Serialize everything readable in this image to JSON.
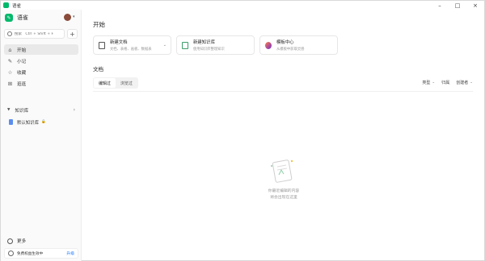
{
  "window": {
    "title": "语雀"
  },
  "sidebar": {
    "brand": "语雀",
    "search_placeholder": "搜索   Ctrl + Shift + F",
    "nav": [
      {
        "label": "开始",
        "icon": "home-icon"
      },
      {
        "label": "小记",
        "icon": "pen-icon"
      },
      {
        "label": "收藏",
        "icon": "star-icon"
      },
      {
        "label": "逛逛",
        "icon": "grid-icon"
      }
    ],
    "knowledge_base": {
      "label": "知识库",
      "items": [
        {
          "label": "默认知识库"
        }
      ]
    },
    "more": "更多",
    "upgrade": {
      "text": "免费权益生效中",
      "link": "升级"
    }
  },
  "main": {
    "heading": "开始",
    "cards": [
      {
        "title": "新建文档",
        "subtitle": "文档、表格、画板、数据表"
      },
      {
        "title": "新建知识库",
        "subtitle": "使用知识库整理知识"
      },
      {
        "title": "模板中心",
        "subtitle": "从模板中获取灵感"
      }
    ],
    "docs_title": "文档",
    "tabs": [
      {
        "label": "编辑过"
      },
      {
        "label": "浏览过"
      }
    ],
    "filters": [
      {
        "label": "类型"
      },
      {
        "label": "归属"
      },
      {
        "label": "创建者"
      }
    ],
    "empty": {
      "line1": "你最近编辑的内容",
      "line2": "将会出现在这里"
    }
  },
  "colors": {
    "brand": "#00b96b",
    "link": "#1677ff"
  }
}
